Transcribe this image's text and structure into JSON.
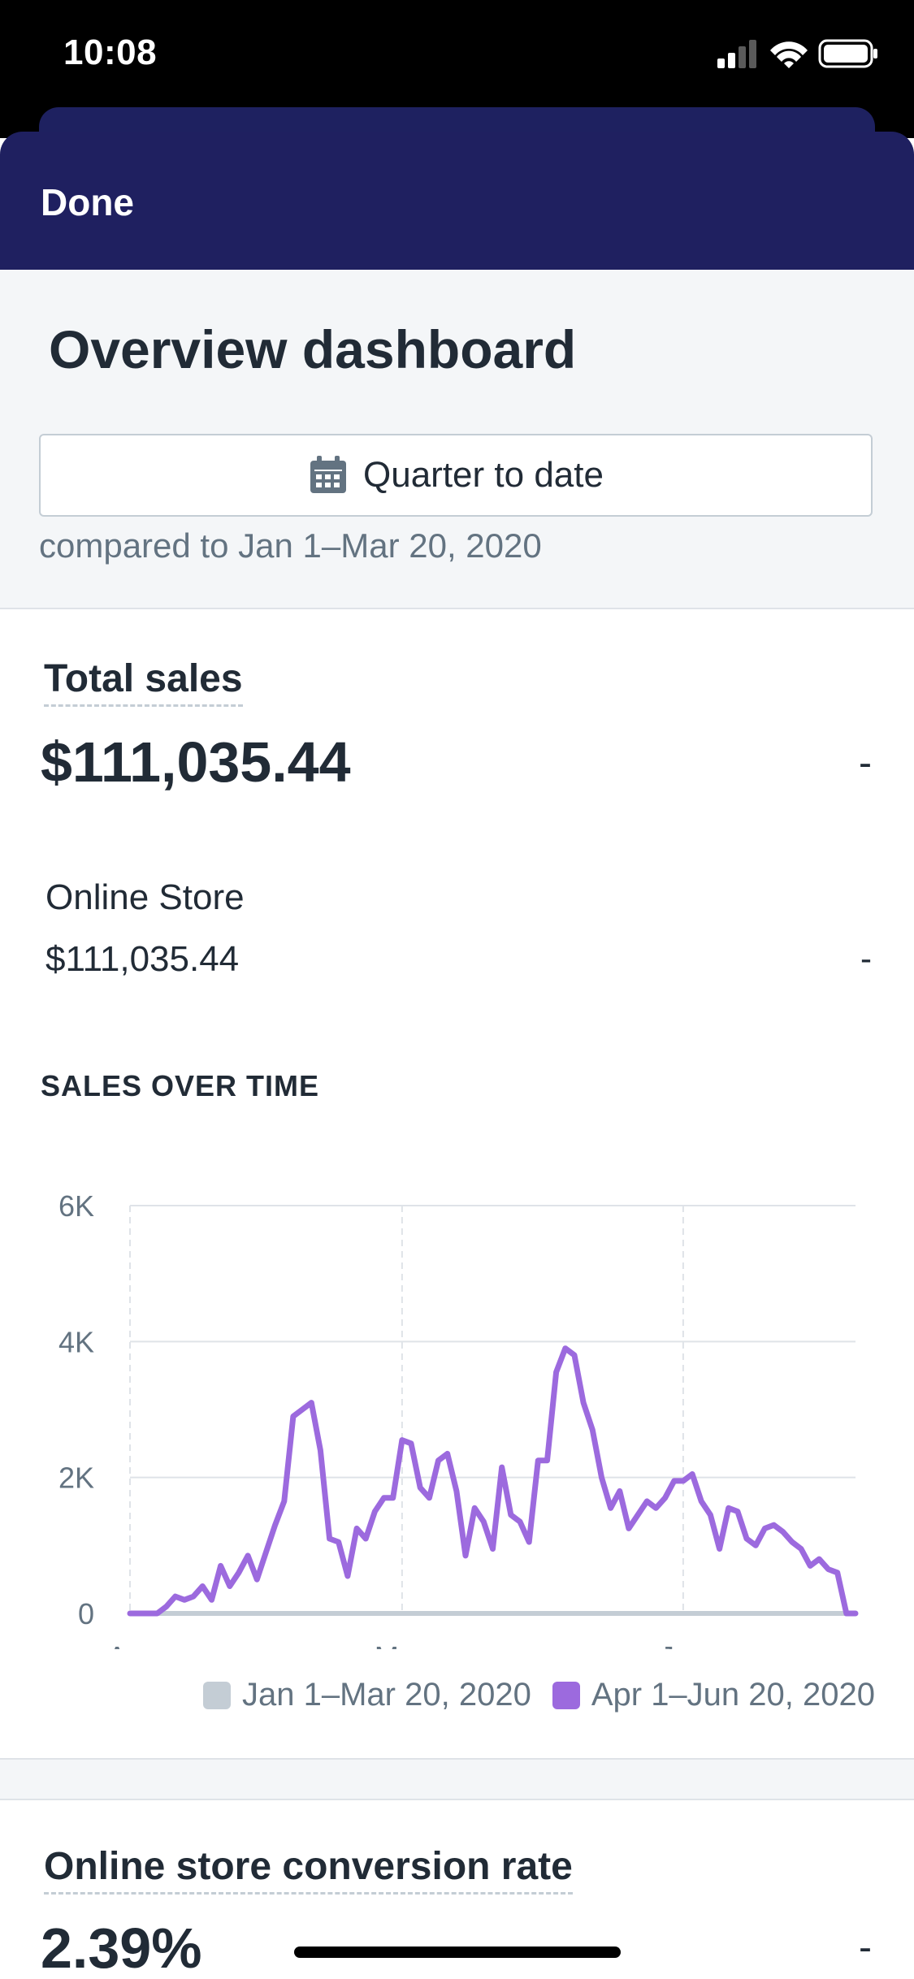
{
  "status_bar": {
    "time": "10:08"
  },
  "nav": {
    "done_label": "Done"
  },
  "header": {
    "title": "Overview dashboard",
    "date_range_button": "Quarter to date",
    "compare_text": "compared to Jan 1–Mar 20, 2020"
  },
  "total_sales": {
    "title": "Total sales",
    "value": "$111,035.44",
    "change": "-",
    "breakdown": [
      {
        "label": "Online Store",
        "value": "$111,035.44",
        "change": "-"
      }
    ]
  },
  "sales_over_time": {
    "label": "SALES OVER TIME",
    "legend": [
      {
        "label": "Jan 1–Mar 20, 2020",
        "color": "#c4cdd5"
      },
      {
        "label": "Apr 1–Jun 20, 2020",
        "color": "#9c6ade"
      }
    ]
  },
  "conversion": {
    "title": "Online store conversion rate",
    "value": "2.39%",
    "change": "-"
  },
  "chart_data": {
    "type": "line",
    "title": "SALES OVER TIME",
    "xlabel": "",
    "ylabel": "",
    "x_ticks": [
      "Apr",
      "May",
      "Jun"
    ],
    "y_ticks": [
      "0",
      "2K",
      "4K",
      "6K"
    ],
    "ylim": [
      0,
      6000
    ],
    "grid": true,
    "legend_position": "bottom-right",
    "series": [
      {
        "name": "Jan 1–Mar 20, 2020",
        "color": "#c4cdd5",
        "values": [
          0,
          0,
          0,
          0,
          0,
          0,
          0,
          0,
          0,
          0,
          0,
          0,
          0,
          0,
          0,
          0,
          0,
          0,
          0,
          0,
          0,
          0,
          0,
          0,
          0,
          0,
          0,
          0,
          0,
          0,
          0,
          0,
          0,
          0,
          0,
          0,
          0,
          0,
          0,
          0,
          0,
          0,
          0,
          0,
          0,
          0,
          0,
          0,
          0,
          0,
          0,
          0,
          0,
          0,
          0,
          0,
          0,
          0,
          0,
          0,
          0,
          0,
          0,
          0,
          0,
          0,
          0,
          0,
          0,
          0,
          0,
          0,
          0,
          0,
          0,
          0,
          0,
          0,
          0,
          0,
          0
        ]
      },
      {
        "name": "Apr 1–Jun 20, 2020",
        "color": "#9c6ade",
        "values": [
          0,
          0,
          0,
          0,
          100,
          250,
          200,
          250,
          400,
          200,
          700,
          400,
          600,
          850,
          500,
          900,
          1300,
          1650,
          2900,
          3000,
          3100,
          2400,
          1100,
          1050,
          550,
          1250,
          1100,
          1500,
          1700,
          1700,
          2550,
          2500,
          1850,
          1700,
          2250,
          2350,
          1800,
          850,
          1550,
          1350,
          950,
          2150,
          1450,
          1350,
          1050,
          2250,
          2250,
          3550,
          3900,
          3800,
          3100,
          2700,
          2000,
          1550,
          1800,
          1250,
          1450,
          1650,
          1550,
          1700,
          1950,
          1950,
          2050,
          1650,
          1450,
          950,
          1550,
          1500,
          1100,
          1000,
          1250,
          1300,
          1200,
          1050,
          950,
          700,
          800,
          650,
          600,
          0,
          0
        ]
      }
    ]
  }
}
